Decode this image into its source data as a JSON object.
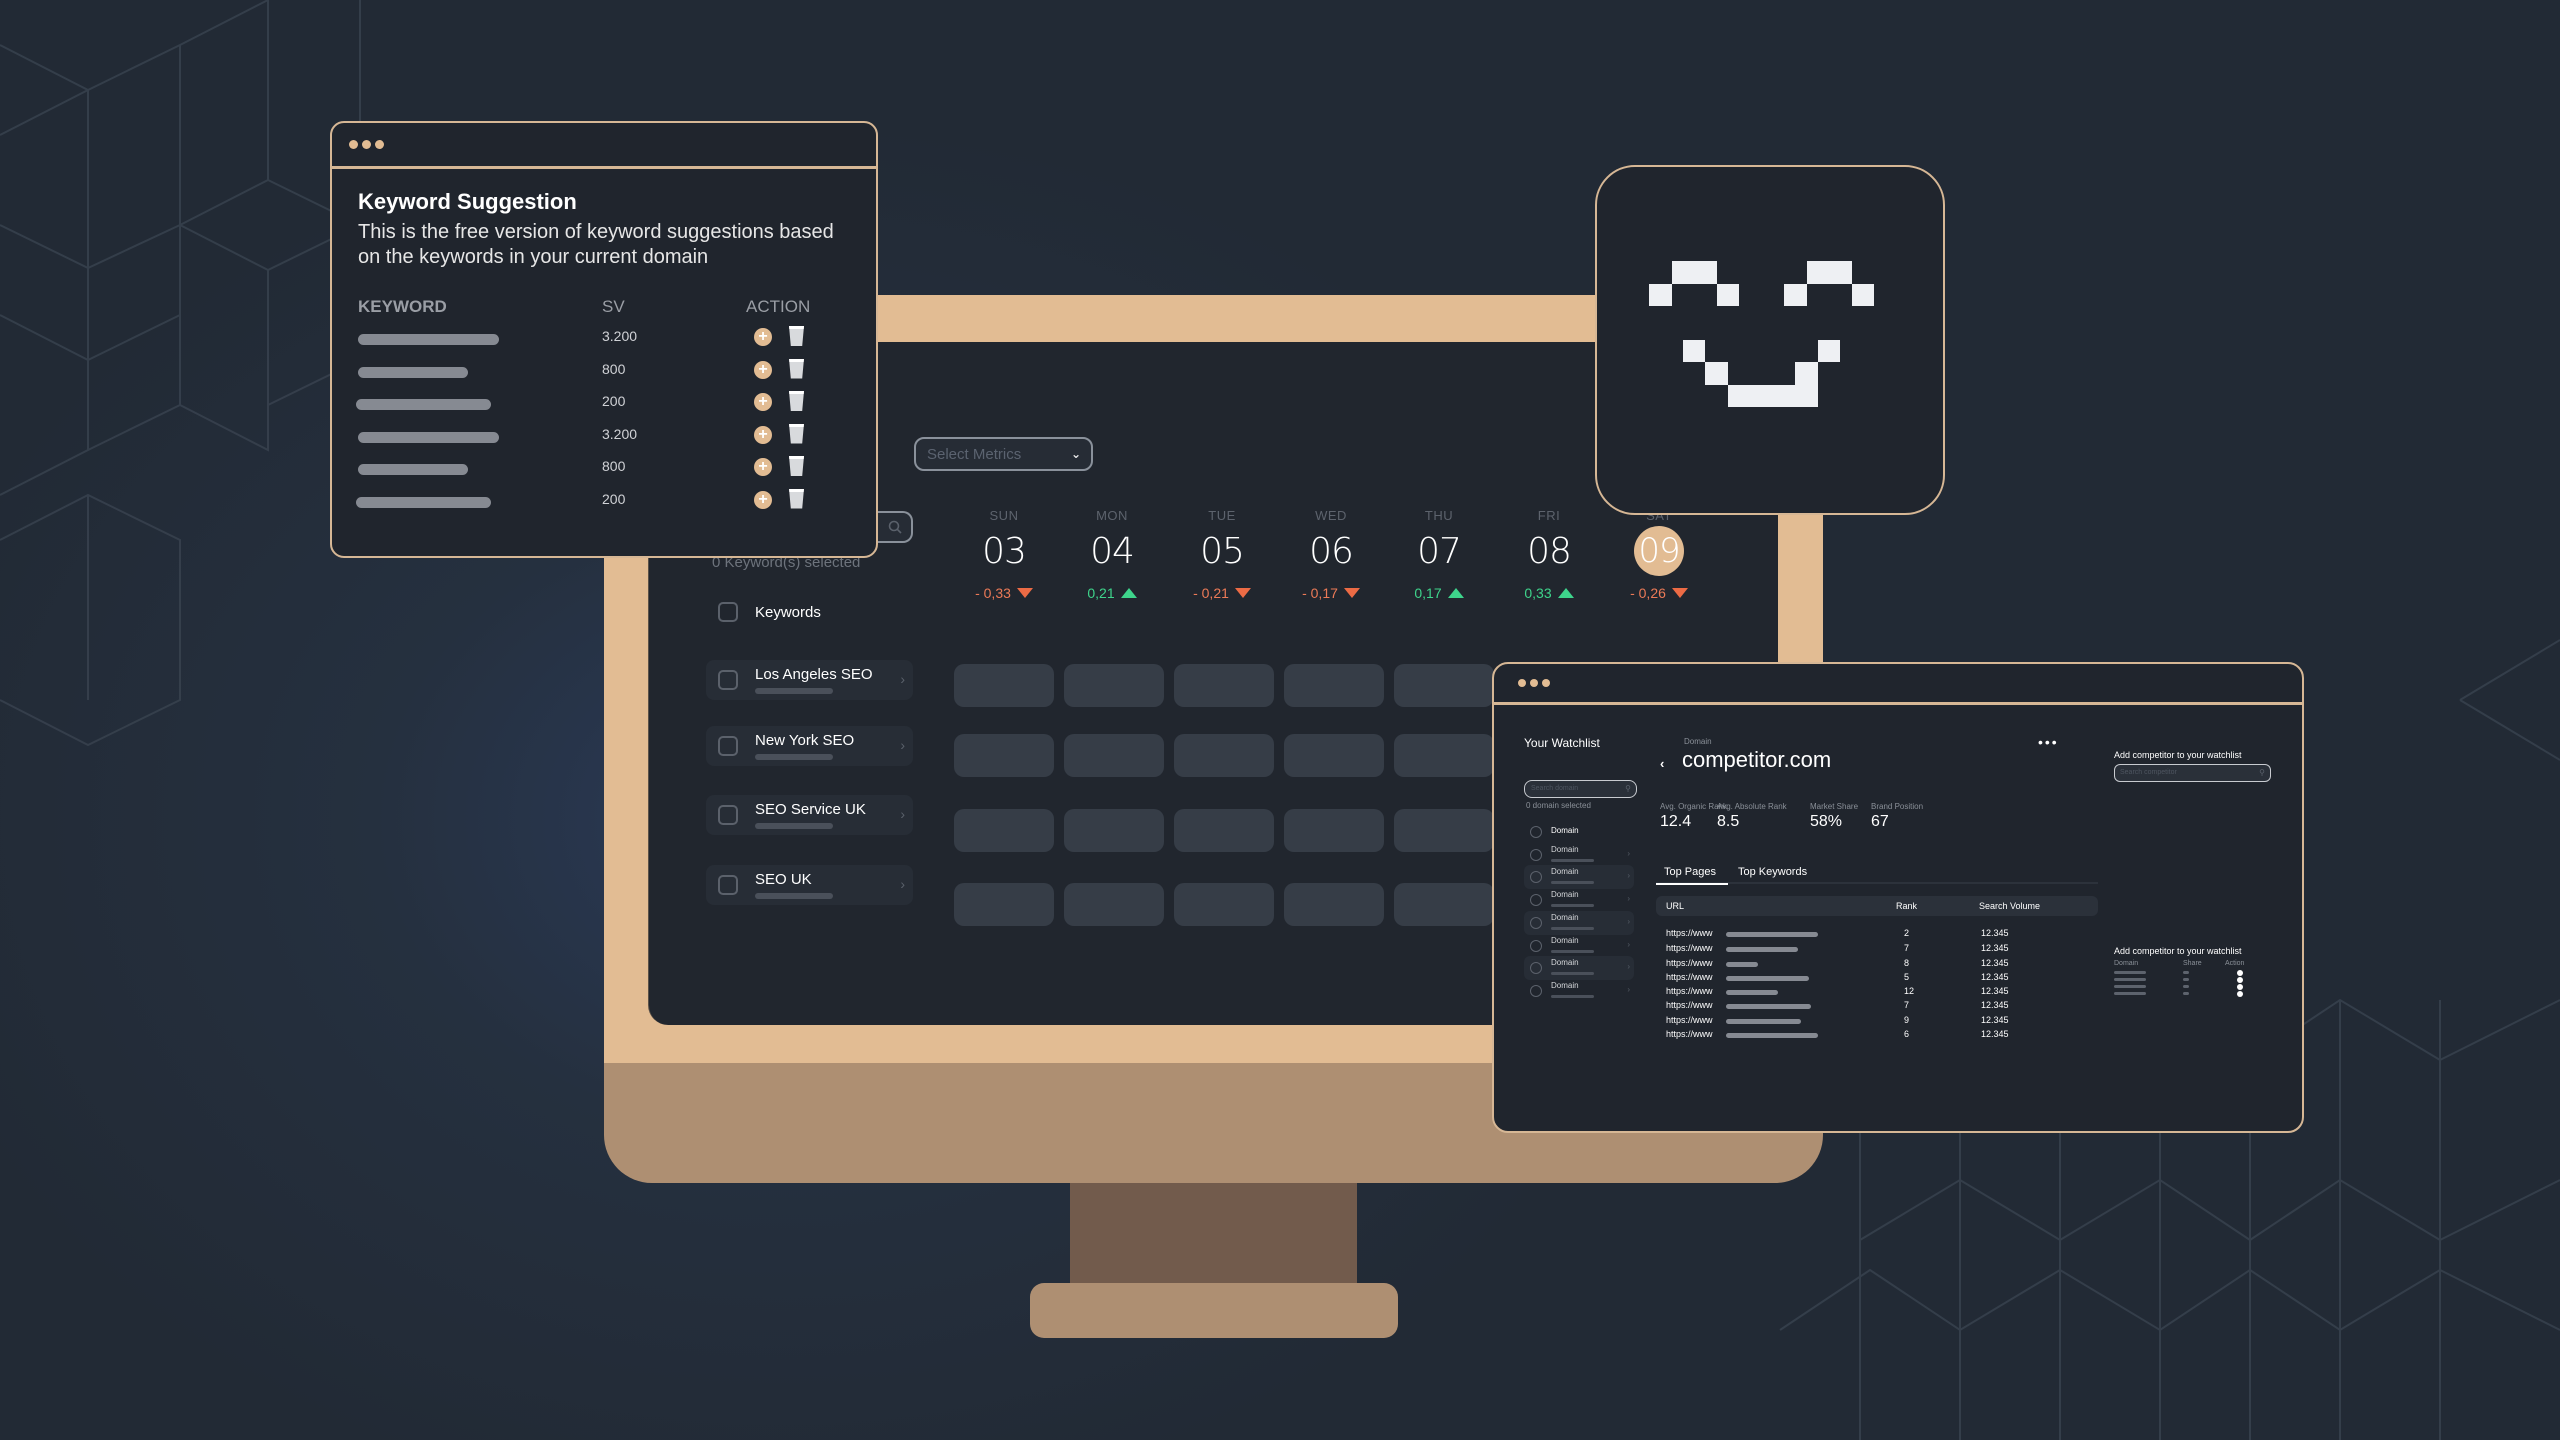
{
  "colors": {
    "background": "#222a35",
    "accent": "#e2bc93",
    "panel": "#20252d",
    "positive": "#3ed48b",
    "negative": "#ec7a57"
  },
  "keyword_suggestion": {
    "title": "Keyword Suggestion",
    "description": "This is the free version of keyword suggestions based on the keywords in your current domain",
    "columns": [
      "KEYWORD",
      "SV",
      "ACTION"
    ],
    "rows": [
      {
        "sv": "3.200",
        "actions": [
          "plus-circle-icon",
          "trash-icon"
        ]
      },
      {
        "sv": "800",
        "actions": [
          "plus-circle-icon",
          "trash-icon"
        ]
      },
      {
        "sv": "200",
        "actions": [
          "plus-circle-icon",
          "trash-icon"
        ]
      },
      {
        "sv": "3.200",
        "actions": [
          "plus-circle-icon",
          "trash-icon"
        ]
      },
      {
        "sv": "800",
        "actions": [
          "plus-circle-icon",
          "trash-icon"
        ]
      },
      {
        "sv": "200",
        "actions": [
          "plus-circle-icon",
          "trash-icon"
        ]
      }
    ]
  },
  "dashboard": {
    "select_metrics_placeholder": "Select Metrics",
    "selected_count": "0 Keyword(s) selected",
    "keywords_header": "Keywords",
    "days": [
      {
        "name": "SUN",
        "date": "03",
        "change": "- 0,33",
        "trend": "down"
      },
      {
        "name": "MON",
        "date": "04",
        "change": "0,21",
        "trend": "up"
      },
      {
        "name": "TUE",
        "date": "05",
        "change": "- 0,21",
        "trend": "down"
      },
      {
        "name": "WED",
        "date": "06",
        "change": "- 0,17",
        "trend": "down"
      },
      {
        "name": "THU",
        "date": "07",
        "change": "0,17",
        "trend": "up"
      },
      {
        "name": "FRI",
        "date": "08",
        "change": "0,33",
        "trend": "up"
      },
      {
        "name": "SAT",
        "date": "09",
        "change": "- 0,26",
        "trend": "down",
        "active": true
      }
    ],
    "keywords": [
      "Los Angeles SEO",
      "New York SEO",
      "SEO Service UK",
      "SEO UK"
    ]
  },
  "competitor": {
    "watchlist_title": "Your Watchlist",
    "search_domain_placeholder": "Search domain",
    "domain_selected": "0 domain selected",
    "watchlist_items": [
      "Domain",
      "Domain",
      "Domain",
      "Domain",
      "Domain",
      "Domain",
      "Domain",
      "Domain"
    ],
    "domain_label": "Domain",
    "domain_name": "competitor.com",
    "more_label": "•••",
    "stats": [
      {
        "label": "Avg. Organic Rank",
        "value": "12.4"
      },
      {
        "label": "Avg. Absolute Rank",
        "value": "8.5"
      },
      {
        "label": "Market Share",
        "value": "58%"
      },
      {
        "label": "Brand Position",
        "value": "67"
      }
    ],
    "tabs": [
      "Top Pages",
      "Top Keywords"
    ],
    "active_tab": "Top Pages",
    "table_columns": [
      "URL",
      "Rank",
      "Search Volume"
    ],
    "table_rows": [
      {
        "url": "https://www",
        "rank": "2",
        "volume": "12.345"
      },
      {
        "url": "https://www",
        "rank": "7",
        "volume": "12.345"
      },
      {
        "url": "https://www",
        "rank": "8",
        "volume": "12.345"
      },
      {
        "url": "https://www",
        "rank": "5",
        "volume": "12.345"
      },
      {
        "url": "https://www",
        "rank": "12",
        "volume": "12.345"
      },
      {
        "url": "https://www",
        "rank": "7",
        "volume": "12.345"
      },
      {
        "url": "https://www",
        "rank": "9",
        "volume": "12.345"
      },
      {
        "url": "https://www",
        "rank": "6",
        "volume": "12.345"
      }
    ],
    "add_competitor_title": "Add competitor to your watchlist",
    "search_competitor_placeholder": "Search competitor",
    "add_competitor_title_2": "Add competitor to your watchlist",
    "mini_columns": [
      "Domain",
      "Share",
      "Action"
    ]
  }
}
